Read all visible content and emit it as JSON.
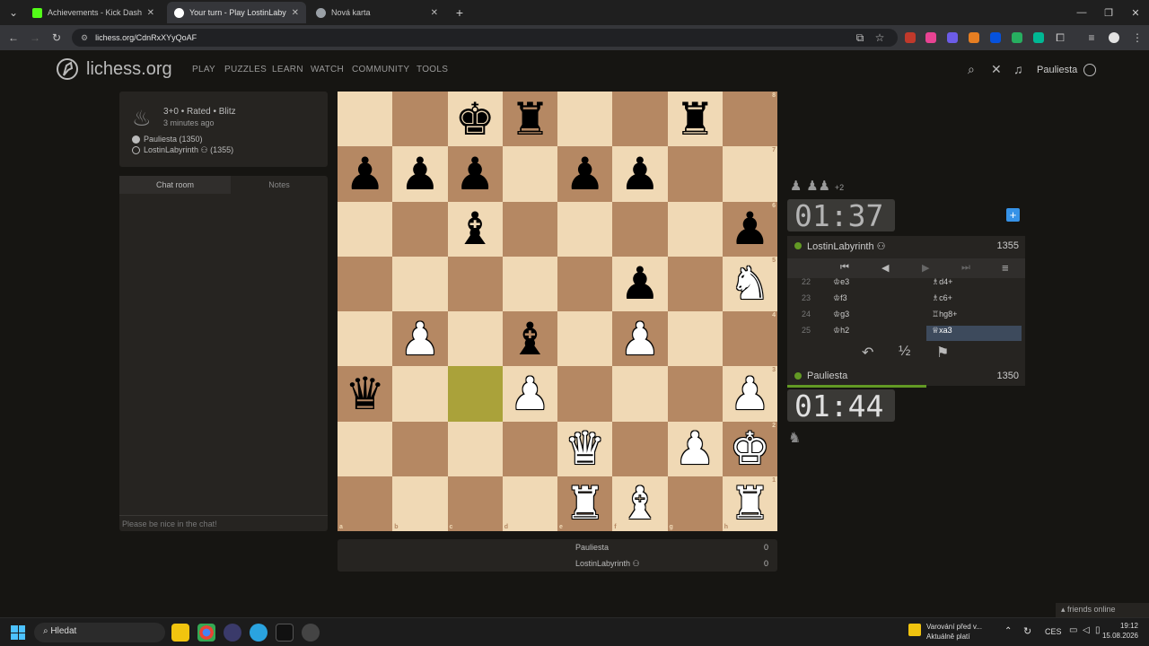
{
  "browser": {
    "tabs": [
      {
        "title": "Achievements - Kick Dashboard",
        "active": false,
        "favicon_color": "#53fc18"
      },
      {
        "title": "Your turn - Play LostinLabyrinth",
        "active": true,
        "favicon_color": "#ffffff"
      },
      {
        "title": "Nová karta",
        "active": false,
        "favicon_color": "#9aa0a6"
      }
    ],
    "new_tab": "+",
    "url": "lichess.org/CdnRxXYyQoAF"
  },
  "header": {
    "logo_text": "lichess.org",
    "nav": [
      "PLAY",
      "PUZZLES",
      "LEARN",
      "WATCH",
      "COMMUNITY",
      "TOOLS"
    ],
    "username": "Pauliesta"
  },
  "game_info": {
    "line1": "3+0 • Rated • Blitz",
    "line2": "3 minutes ago",
    "players": [
      "Pauliesta (1350)",
      "LostinLabyrinth ⚇ (1355)"
    ]
  },
  "chat": {
    "tabs": [
      "Chat room",
      "Notes"
    ],
    "placeholder": "Please be nice in the chat!"
  },
  "board": {
    "ranks": [
      [
        "",
        "",
        "bk",
        "br",
        "",
        "",
        "br",
        ""
      ],
      [
        "bp",
        "bp",
        "bp",
        "",
        "bp",
        "bp",
        "",
        ""
      ],
      [
        "",
        "",
        "bb",
        "",
        "",
        "",
        "",
        "bp"
      ],
      [
        "",
        "",
        "",
        "",
        "",
        "bp",
        "",
        "wn"
      ],
      [
        "",
        "wp",
        "",
        "bb",
        "",
        "wp",
        "",
        ""
      ],
      [
        "bq",
        "",
        "hl",
        "wp",
        "",
        "",
        "",
        "wp"
      ],
      [
        "",
        "",
        "",
        "",
        "wq",
        "",
        "wp",
        "wk"
      ],
      [
        "",
        "",
        "",
        "",
        "wr",
        "wb",
        "",
        "wr"
      ]
    ],
    "files": [
      "a",
      "b",
      "c",
      "d",
      "e",
      "f",
      "g",
      "h"
    ],
    "rank_labels": [
      "8",
      "7",
      "6",
      "5",
      "4",
      "3",
      "2",
      "1"
    ]
  },
  "opponent": {
    "captured": "♟ ♟♟",
    "material": "+2",
    "clock": "01:37",
    "name": "LostinLabyrinth ⚇",
    "rating": "1355"
  },
  "player": {
    "name": "Pauliesta",
    "rating": "1350",
    "clock": "01:44"
  },
  "moves": [
    {
      "n": "22",
      "w": "♔e3",
      "b": "♗d4+"
    },
    {
      "n": "23",
      "w": "♔f3",
      "b": "♗c6+"
    },
    {
      "n": "24",
      "w": "♔g3",
      "b": "♖hg8+"
    },
    {
      "n": "25",
      "w": "♔h2",
      "b": "♕xa3"
    }
  ],
  "move_controls": [
    "⏮",
    "◀",
    "▶",
    "⏭",
    "≡"
  ],
  "game_controls": [
    "↶",
    "½",
    "⚑"
  ],
  "scores": [
    {
      "name": "Pauliesta",
      "score": "0"
    },
    {
      "name": "LostinLabyrinth ⚇",
      "score": "0"
    }
  ],
  "friends": "friends online",
  "taskbar": {
    "search": "Hledat",
    "notice_line1": "Varování před v...",
    "notice_line2": "Aktuálně platí",
    "lang": "CES",
    "time": "19:12",
    "date": "15.08.2026"
  }
}
